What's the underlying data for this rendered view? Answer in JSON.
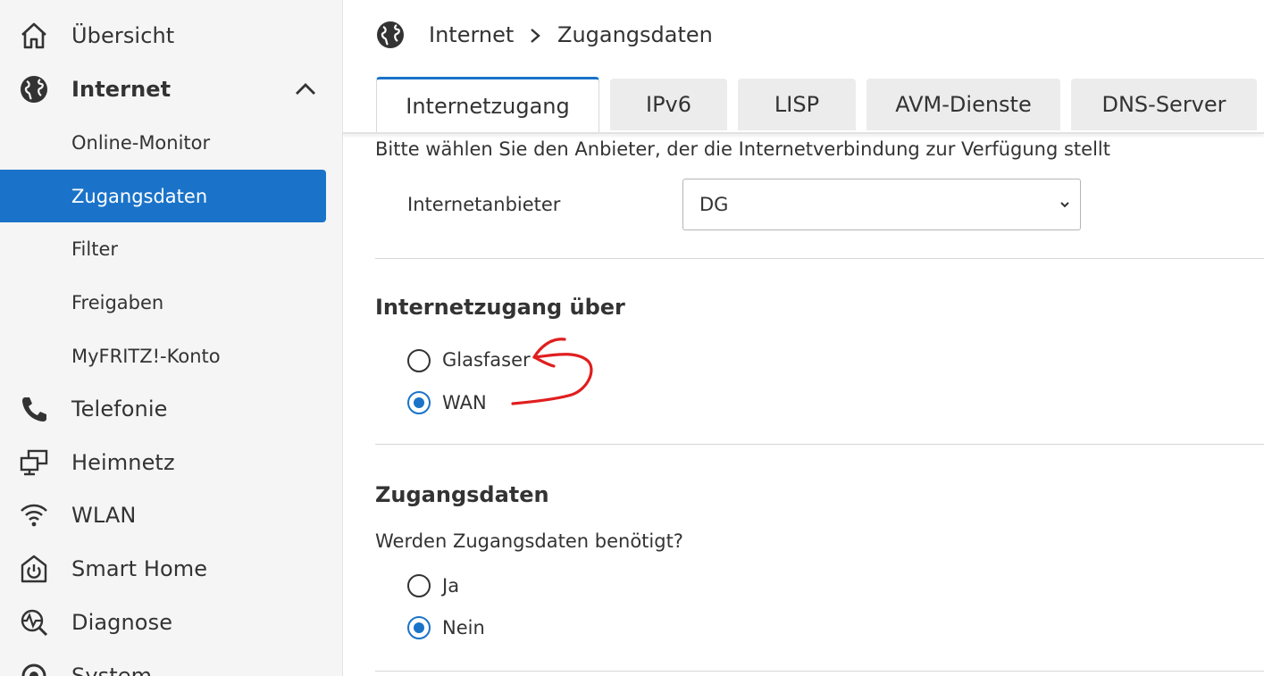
{
  "sidebar": {
    "items": [
      {
        "label": "Übersicht",
        "icon": "home-icon"
      },
      {
        "label": "Internet",
        "icon": "globe-icon",
        "expanded": true,
        "children": [
          {
            "label": "Online-Monitor"
          },
          {
            "label": "Zugangsdaten",
            "active": true
          },
          {
            "label": "Filter"
          },
          {
            "label": "Freigaben"
          },
          {
            "label": "MyFRITZ!-Konto"
          }
        ]
      },
      {
        "label": "Telefonie",
        "icon": "phone-icon"
      },
      {
        "label": "Heimnetz",
        "icon": "network-icon"
      },
      {
        "label": "WLAN",
        "icon": "wifi-icon"
      },
      {
        "label": "Smart Home",
        "icon": "smart-home-icon"
      },
      {
        "label": "Diagnose",
        "icon": "diagnose-icon"
      },
      {
        "label": "System",
        "icon": "system-icon"
      }
    ]
  },
  "header": {
    "breadcrumb": [
      "Internet",
      "Zugangsdaten"
    ]
  },
  "tabs": [
    {
      "label": "Internetzugang",
      "active": true
    },
    {
      "label": "IPv6"
    },
    {
      "label": "LISP"
    },
    {
      "label": "AVM-Dienste"
    },
    {
      "label": "DNS-Server"
    }
  ],
  "provider": {
    "instruction": "Bitte wählen Sie den Anbieter, der die Internetverbindung zur Verfügung stellt",
    "label": "Internetanbieter",
    "selected": "DG"
  },
  "access_via": {
    "heading": "Internetzugang über",
    "options": [
      {
        "label": "Glasfaser",
        "checked": false
      },
      {
        "label": "WAN",
        "checked": true
      }
    ]
  },
  "credentials": {
    "heading": "Zugangsdaten",
    "question": "Werden Zugangsdaten benötigt?",
    "options": [
      {
        "label": "Ja",
        "checked": false
      },
      {
        "label": "Nein",
        "checked": true
      }
    ]
  },
  "colors": {
    "accent": "#1a73c9",
    "annotation": "#e01e1e"
  }
}
